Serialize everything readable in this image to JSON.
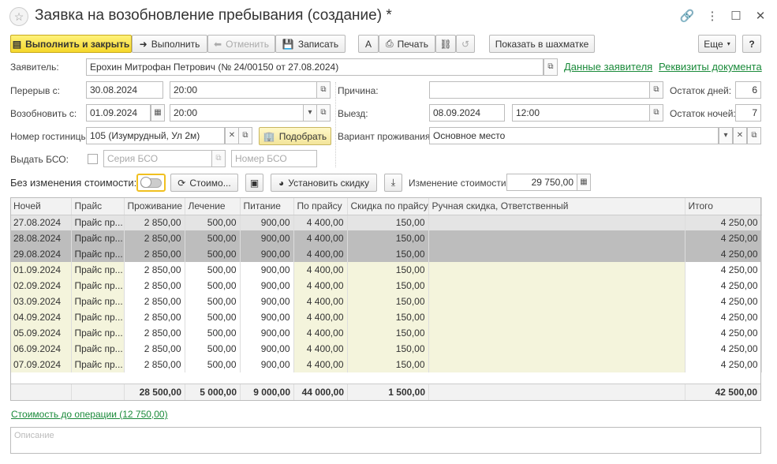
{
  "window": {
    "title": "Заявка на возобновление пребывания (создание) *"
  },
  "toolbar": {
    "execute_close": "Выполнить и закрыть",
    "execute": "Выполнить",
    "cancel": "Отменить",
    "save": "Записать",
    "print": "Печать",
    "show_chess": "Показать в шахматке",
    "more": "Еще",
    "help": "?"
  },
  "form": {
    "applicant_label": "Заявитель:",
    "applicant_value": "Ерохин Митрофан Петрович (№ 24/00150 от 27.08.2024)",
    "applicant_data_link": "Данные заявителя",
    "doc_details_link": "Реквизиты документа",
    "break_label": "Перерыв с:",
    "break_date": "30.08.2024",
    "break_time": "20:00",
    "resume_label": "Возобновить с:",
    "resume_date": "01.09.2024",
    "resume_time": "20:00",
    "hotel_room_label": "Номер гостиницы:",
    "hotel_room_value": "105 (Изумрудный, Ул 2м)",
    "pick_button": "Подобрать",
    "bso_label": "Выдать БСО:",
    "bso_series_ph": "Серия БСО",
    "bso_number_ph": "Номер БСО",
    "reason_label": "Причина:",
    "reason_value": "",
    "departure_label": "Выезд:",
    "departure_date": "08.09.2024",
    "departure_time": "12:00",
    "accommodation_label": "Вариант проживания:",
    "accommodation_value": "Основное место",
    "days_left_label": "Остаток дней:",
    "days_left_value": "6",
    "nights_left_label": "Остаток ночей:",
    "nights_left_value": "7"
  },
  "cost_bar": {
    "no_change_label": "Без изменения стоимости:",
    "cost_button": "Стоимо...",
    "set_discount_button": "Установить скидку",
    "change_cost_label": "Изменение стоимости:",
    "change_cost_value": "29 750,00"
  },
  "table": {
    "headers": [
      "Ночей",
      "Прайс",
      "Проживание",
      "Лечение",
      "Питание",
      "По прайсу",
      "Скидка по прайсу",
      "Ручная скидка, Ответственный",
      "Итого"
    ],
    "rows": [
      [
        "27.08.2024",
        "Прайс пр...",
        "2 850,00",
        "500,00",
        "900,00",
        "4 400,00",
        "150,00",
        "",
        "4 250,00"
      ],
      [
        "28.08.2024",
        "Прайс пр...",
        "2 850,00",
        "500,00",
        "900,00",
        "4 400,00",
        "150,00",
        "",
        "4 250,00"
      ],
      [
        "29.08.2024",
        "Прайс пр...",
        "2 850,00",
        "500,00",
        "900,00",
        "4 400,00",
        "150,00",
        "",
        "4 250,00"
      ],
      [
        "01.09.2024",
        "Прайс пр...",
        "2 850,00",
        "500,00",
        "900,00",
        "4 400,00",
        "150,00",
        "",
        "4 250,00"
      ],
      [
        "02.09.2024",
        "Прайс пр...",
        "2 850,00",
        "500,00",
        "900,00",
        "4 400,00",
        "150,00",
        "",
        "4 250,00"
      ],
      [
        "03.09.2024",
        "Прайс пр...",
        "2 850,00",
        "500,00",
        "900,00",
        "4 400,00",
        "150,00",
        "",
        "4 250,00"
      ],
      [
        "04.09.2024",
        "Прайс пр...",
        "2 850,00",
        "500,00",
        "900,00",
        "4 400,00",
        "150,00",
        "",
        "4 250,00"
      ],
      [
        "05.09.2024",
        "Прайс пр...",
        "2 850,00",
        "500,00",
        "900,00",
        "4 400,00",
        "150,00",
        "",
        "4 250,00"
      ],
      [
        "06.09.2024",
        "Прайс пр...",
        "2 850,00",
        "500,00",
        "900,00",
        "4 400,00",
        "150,00",
        "",
        "4 250,00"
      ],
      [
        "07.09.2024",
        "Прайс пр...",
        "2 850,00",
        "500,00",
        "900,00",
        "4 400,00",
        "150,00",
        "",
        "4 250,00"
      ]
    ],
    "totals": {
      "living": "28 500,00",
      "treatment": "5 000,00",
      "food": "9 000,00",
      "price": "44 000,00",
      "discount": "1 500,00",
      "total": "42 500,00"
    }
  },
  "bottom": {
    "cost_before_link": "Стоимость до операции (12 750,00)",
    "description_ph": "Описание"
  }
}
